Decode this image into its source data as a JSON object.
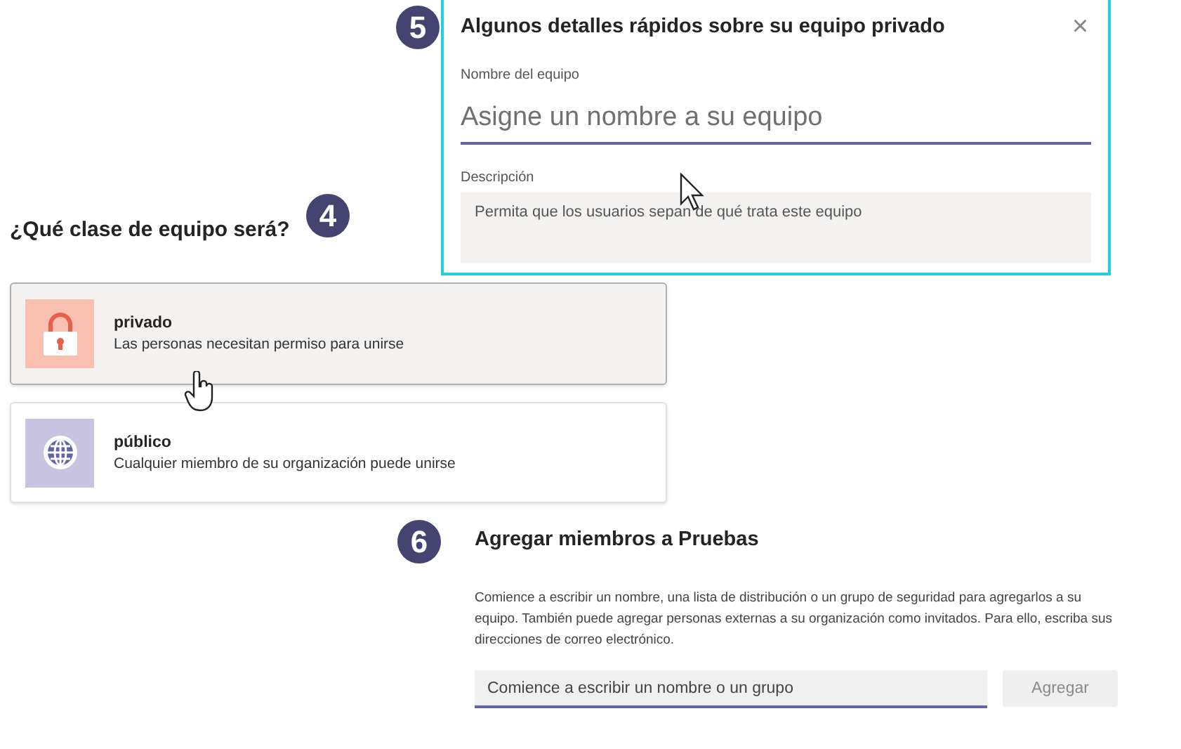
{
  "details_panel": {
    "step": "5",
    "title": "Algunos detalles rápidos sobre su equipo privado",
    "close": "×",
    "name_label": "Nombre del equipo",
    "name_placeholder": "Asigne un nombre a su equipo",
    "description_label": "Descripción",
    "description_placeholder": "Permita que los usuarios sepan de qué trata este equipo"
  },
  "team_type": {
    "step": "4",
    "heading": "¿Qué clase de equipo será?",
    "options": [
      {
        "kind": "private",
        "title": "privado",
        "description": "Las personas necesitan permiso para unirse",
        "selected": true
      },
      {
        "kind": "public",
        "title": "público",
        "description": "Cualquier miembro de su organización puede unirse",
        "selected": false
      }
    ]
  },
  "members": {
    "step": "6",
    "title": "Agregar miembros a Pruebas",
    "instructions": "Comience a escribir un nombre, una lista de distribución o un grupo de seguridad para agregarlos a su equipo. También puede agregar personas externas a su organización como invitados. Para ello, escriba sus direcciones de correo electrónico.",
    "search_placeholder": "Comience a escribir un nombre o un grupo",
    "add_button": {
      "label": "Agregar",
      "disabled": true
    }
  }
}
